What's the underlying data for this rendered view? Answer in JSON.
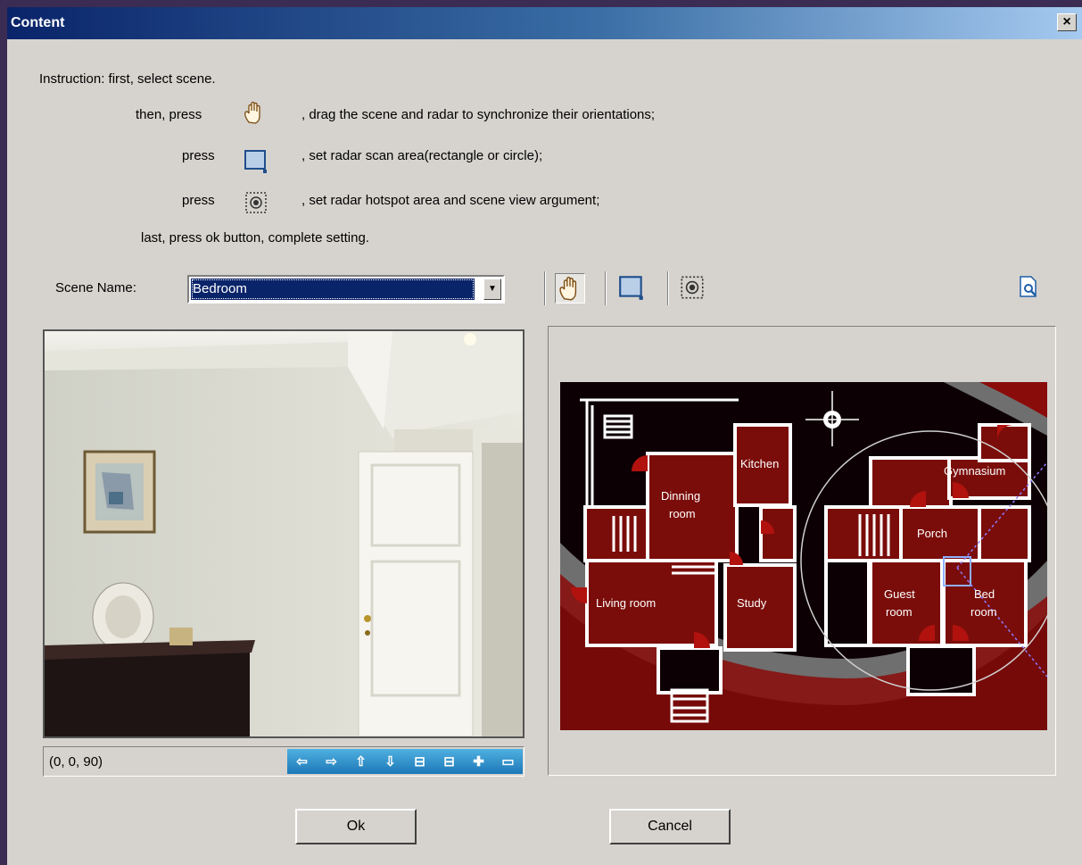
{
  "window": {
    "title": "Content",
    "close_label": "×"
  },
  "instructions": {
    "line1": "Instruction: first, select scene.",
    "line2_prefix": "then, press",
    "line2_suffix": ", drag the scene and radar to synchronize their orientations;",
    "line3_prefix": "press",
    "line3_suffix": ", set radar scan area(rectangle or circle);",
    "line4_prefix": "press",
    "line4_suffix": ", set radar hotspot area and scene view argument;",
    "line5": "last, press ok button, complete setting.",
    "icons": [
      "hand-icon",
      "rectangle-icon",
      "hotspot-icon"
    ]
  },
  "scene": {
    "label": "Scene Name:",
    "selected": "Bedroom"
  },
  "toolbar": {
    "tools": [
      "hand-tool",
      "rectangle-tool",
      "hotspot-tool"
    ],
    "active": "hand-tool",
    "preview_icon": "preview-icon"
  },
  "scene_view": {
    "coords": "(0, 0, 90)",
    "nav_buttons": [
      "⇦",
      "⇨",
      "⇧",
      "⇩",
      "⊟",
      "⊟",
      "✚",
      "▭"
    ]
  },
  "radar": {
    "rooms": [
      "Kitchen",
      "Dinning room",
      "Living room",
      "Study",
      "Gymnasium",
      "Porch",
      "Guest room",
      "Bed room"
    ],
    "room_labels": {
      "kitchen": "Kitchen",
      "dinning1": "Dinning",
      "dinning2": "room",
      "living": "Living room",
      "study": "Study",
      "gym": "Gymnasium",
      "porch": "Porch",
      "guest1": "Guest",
      "guest2": "room",
      "bed1": "Bed",
      "bed2": "room"
    },
    "colors": {
      "room": "#7a0d0a",
      "bg": "#0d0004",
      "accent_red": "#b1120e",
      "wall": "#ffffff"
    }
  },
  "buttons": {
    "ok": "Ok",
    "cancel": "Cancel"
  }
}
